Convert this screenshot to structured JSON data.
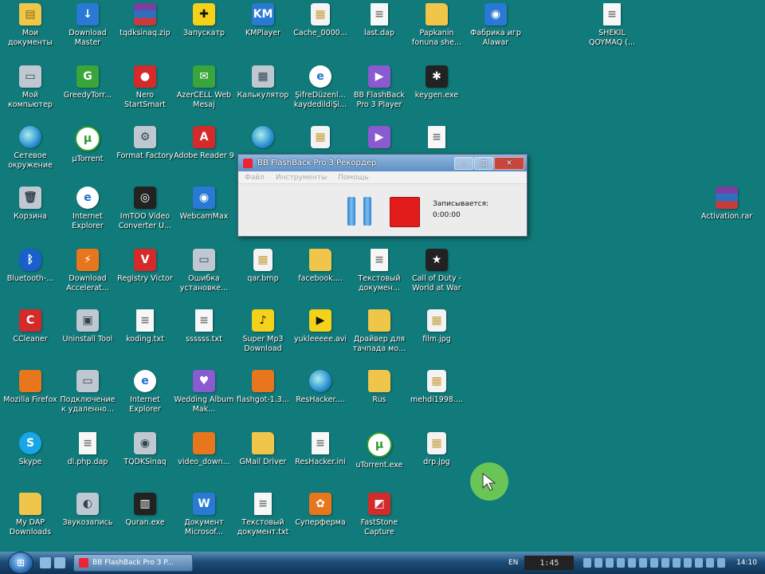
{
  "desktop_icons": [
    {
      "label": "Мои документы",
      "glyph": "folder-icon",
      "symbol": "▤",
      "kind": "g-folder"
    },
    {
      "label": "Download Master",
      "glyph": "download-icon",
      "symbol": "↓",
      "kind": "g-blue"
    },
    {
      "label": "tqdksinaq.zip",
      "glyph": "archive-icon",
      "symbol": "",
      "kind": "g-rar"
    },
    {
      "label": "Запускатр",
      "glyph": "puzzle-icon",
      "symbol": "✚",
      "kind": "g-yellow"
    },
    {
      "label": "KMPlayer",
      "glyph": "media-player-icon",
      "symbol": "KM",
      "kind": "g-blue"
    },
    {
      "label": "Cache_0000...",
      "glyph": "image-file-icon",
      "symbol": "▦",
      "kind": "g-img"
    },
    {
      "label": "last.dap",
      "glyph": "document-icon",
      "symbol": "≡",
      "kind": "g-doc"
    },
    {
      "label": "Papkanin fonuna she...",
      "glyph": "folder-icon",
      "symbol": "",
      "kind": "g-folder"
    },
    {
      "label": "Фабрика игр Alawar",
      "glyph": "game-icon",
      "symbol": "◉",
      "kind": "g-blue"
    },
    {
      "label": "SHEKIL QOYMAQ (...",
      "glyph": "document-icon",
      "symbol": "≡",
      "kind": "g-doc"
    },
    {
      "label": "Мой компьютер",
      "glyph": "computer-icon",
      "symbol": "▭",
      "kind": "g-grey"
    },
    {
      "label": "GreedyTorr...",
      "glyph": "torrent-icon",
      "symbol": "G",
      "kind": "g-green"
    },
    {
      "label": "Nero StartSmart",
      "glyph": "nero-icon",
      "symbol": "●",
      "kind": "g-red"
    },
    {
      "label": "AzerCELL Web Mesaj",
      "glyph": "sms-icon",
      "symbol": "✉",
      "kind": "g-green"
    },
    {
      "label": "Калькулятор",
      "glyph": "calculator-icon",
      "symbol": "▦",
      "kind": "g-grey"
    },
    {
      "label": "ŞifreDüzenl... kaydedildiŞi...",
      "glyph": "ie-icon",
      "symbol": "e",
      "kind": "g-ie"
    },
    {
      "label": "BB FlashBack Pro 3 Player",
      "glyph": "player-icon",
      "symbol": "▶",
      "kind": "g-purple"
    },
    {
      "label": "keygen.exe",
      "glyph": "keygen-icon",
      "symbol": "✱",
      "kind": "g-dark"
    },
    {
      "label": "Сетевое окружение",
      "glyph": "network-icon",
      "symbol": "",
      "kind": "g-globe"
    },
    {
      "label": "µTorrent",
      "glyph": "utorrent-icon",
      "symbol": "µ",
      "kind": "g-utor"
    },
    {
      "label": "Format Factory",
      "glyph": "format-factory-icon",
      "symbol": "⚙",
      "kind": "g-grey"
    },
    {
      "label": "Adobe Reader 9",
      "glyph": "pdf-icon",
      "symbol": "A",
      "kind": "g-red"
    },
    {
      "label": "",
      "glyph": "globe-icon",
      "symbol": "",
      "kind": "g-globe"
    },
    {
      "label": "",
      "glyph": "image-file-icon",
      "symbol": "▦",
      "kind": "g-img"
    },
    {
      "label": "",
      "glyph": "player-icon",
      "symbol": "▶",
      "kind": "g-purple"
    },
    {
      "label": "",
      "glyph": "document-icon",
      "symbol": "≡",
      "kind": "g-doc"
    },
    {
      "label": "Корзина",
      "glyph": "recycle-bin-icon",
      "symbol": "🗑",
      "kind": "g-grey"
    },
    {
      "label": "Internet Explorer",
      "glyph": "ie-icon",
      "symbol": "e",
      "kind": "g-ie"
    },
    {
      "label": "ImTOO Video Converter U...",
      "glyph": "video-converter-icon",
      "symbol": "◎",
      "kind": "g-dark"
    },
    {
      "label": "WebcamMax",
      "glyph": "webcam-icon",
      "symbol": "◉",
      "kind": "g-blue"
    },
    {
      "label": "Activation.rar",
      "glyph": "archive-icon",
      "symbol": "",
      "kind": "g-rar"
    },
    {
      "label": "Bluetooth-...",
      "glyph": "bluetooth-icon",
      "symbol": "ᛒ",
      "kind": "g-bt"
    },
    {
      "label": "Download Accelerat...",
      "glyph": "download-accelerator-icon",
      "symbol": "⚡",
      "kind": "g-orange"
    },
    {
      "label": "Registry Victor",
      "glyph": "registry-icon",
      "symbol": "V",
      "kind": "g-red"
    },
    {
      "label": "Ошибка установке...",
      "glyph": "window-icon",
      "symbol": "▭",
      "kind": "g-grey"
    },
    {
      "label": "qar.bmp",
      "glyph": "image-file-icon",
      "symbol": "▦",
      "kind": "g-img"
    },
    {
      "label": "facebook....",
      "glyph": "folder-icon",
      "symbol": "",
      "kind": "g-folder"
    },
    {
      "label": "Текстовый докумен...",
      "glyph": "document-icon",
      "symbol": "≡",
      "kind": "g-doc"
    },
    {
      "label": "Call of Duty - World at War",
      "glyph": "game-icon",
      "symbol": "★",
      "kind": "g-dark"
    },
    {
      "label": "CCleaner",
      "glyph": "ccleaner-icon",
      "symbol": "C",
      "kind": "g-red"
    },
    {
      "label": "Uninstall Tool",
      "glyph": "uninstall-icon",
      "symbol": "▣",
      "kind": "g-grey"
    },
    {
      "label": "koding.txt",
      "glyph": "document-icon",
      "symbol": "≡",
      "kind": "g-doc"
    },
    {
      "label": "ssssss.txt",
      "glyph": "document-icon",
      "symbol": "≡",
      "kind": "g-doc"
    },
    {
      "label": "Super Mp3 Download",
      "glyph": "mp3-icon",
      "symbol": "♪",
      "kind": "g-yellow"
    },
    {
      "label": "yukleeeee.avi",
      "glyph": "video-file-icon",
      "symbol": "▶",
      "kind": "g-yellow"
    },
    {
      "label": "Драйвер для тачпада мо...",
      "glyph": "folder-icon",
      "symbol": "",
      "kind": "g-folder"
    },
    {
      "label": "film.jpg",
      "glyph": "image-file-icon",
      "symbol": "▦",
      "kind": "g-img"
    },
    {
      "label": "Mozilla Firefox",
      "glyph": "firefox-icon",
      "symbol": "",
      "kind": "g-orange"
    },
    {
      "label": "Подключение к удаленно...",
      "glyph": "remote-desktop-icon",
      "symbol": "▭",
      "kind": "g-grey"
    },
    {
      "label": "Internet Explorer",
      "glyph": "ie-icon",
      "symbol": "e",
      "kind": "g-ie"
    },
    {
      "label": "Wedding Album Mak...",
      "glyph": "album-icon",
      "symbol": "♥",
      "kind": "g-purple"
    },
    {
      "label": "flashgot-1.3...",
      "glyph": "firefox-file-icon",
      "symbol": "",
      "kind": "g-orange"
    },
    {
      "label": "ResHacker....",
      "glyph": "reshacker-icon",
      "symbol": "",
      "kind": "g-globe"
    },
    {
      "label": "Rus",
      "glyph": "folder-icon",
      "symbol": "",
      "kind": "g-folder"
    },
    {
      "label": "mehdi1998....",
      "glyph": "image-file-icon",
      "symbol": "▦",
      "kind": "g-img"
    },
    {
      "label": "Skype",
      "glyph": "skype-icon",
      "symbol": "S",
      "kind": "g-skype"
    },
    {
      "label": "dl.php.dap",
      "glyph": "document-icon",
      "symbol": "≡",
      "kind": "g-doc"
    },
    {
      "label": "TQDKSinaq",
      "glyph": "network-drive-icon",
      "symbol": "◉",
      "kind": "g-grey"
    },
    {
      "label": "video_down...",
      "glyph": "firefox-file-icon",
      "symbol": "",
      "kind": "g-orange"
    },
    {
      "label": "GMail Driver",
      "glyph": "folder-icon",
      "symbol": "",
      "kind": "g-folder"
    },
    {
      "label": "ResHacker.ini",
      "glyph": "ini-file-icon",
      "symbol": "≡",
      "kind": "g-doc"
    },
    {
      "label": "uTorrent.exe",
      "glyph": "utorrent-icon",
      "symbol": "µ",
      "kind": "g-utor"
    },
    {
      "label": "drp.jpg",
      "glyph": "image-file-icon",
      "symbol": "▦",
      "kind": "g-img"
    },
    {
      "label": "My DAP Downloads",
      "glyph": "folder-icon",
      "symbol": "",
      "kind": "g-folder"
    },
    {
      "label": "Звукозапись",
      "glyph": "microphone-icon",
      "symbol": "◐",
      "kind": "g-grey"
    },
    {
      "label": "Quran.exe",
      "glyph": "book-icon",
      "symbol": "▥",
      "kind": "g-dark"
    },
    {
      "label": "Документ Microsof...",
      "glyph": "word-document-icon",
      "symbol": "W",
      "kind": "g-blue"
    },
    {
      "label": "Текстовый документ.txt",
      "glyph": "document-icon",
      "symbol": "≡",
      "kind": "g-doc"
    },
    {
      "label": "Суперферма",
      "glyph": "game-icon",
      "symbol": "✿",
      "kind": "g-orange"
    },
    {
      "label": "FastStone Capture",
      "glyph": "capture-icon",
      "symbol": "◩",
      "kind": "g-red"
    }
  ],
  "recorder_window": {
    "title": "BB FlashBack Pro 3 Рекордер",
    "menu": [
      "Файл",
      "Инструменты",
      "Помощь"
    ],
    "status_label": "Записывается:",
    "elapsed": "0:00:00",
    "minimize_symbol": "–",
    "maximize_symbol": "□",
    "close_symbol": "✕"
  },
  "taskbar": {
    "start_symbol": "⊞",
    "task_label": "BB FlashBack Pro 3 P...",
    "language": "EN",
    "recording_timer": "1:45",
    "clock": "14:10"
  },
  "colors": {
    "desktop_background": "#117b7b",
    "cursor_highlight": "#78d250"
  }
}
